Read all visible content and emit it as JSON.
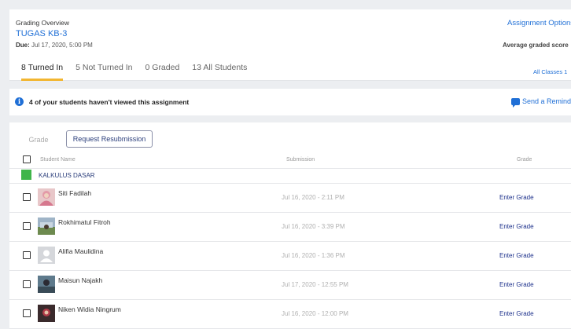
{
  "header": {
    "overview_label": "Grading Overview",
    "assignment_title": "TUGAS KB-3",
    "due_label": "Due:",
    "due_value": "Jul 17, 2020, 5:00 PM",
    "assignment_options": "Assignment Options",
    "average_label": "Average graded score"
  },
  "tabs": [
    {
      "label": "8 Turned In",
      "active": true
    },
    {
      "label": "5 Not Turned In",
      "active": false
    },
    {
      "label": "0 Graded",
      "active": false
    },
    {
      "label": "13 All Students",
      "active": false
    }
  ],
  "filter": {
    "classes_label": "All Classes 1"
  },
  "notice": {
    "text": "4 of your students haven't viewed this assignment",
    "remind_label": "Send a Reminder"
  },
  "toolbar": {
    "grade_label": "Grade",
    "resubmission_label": "Request Resubmission"
  },
  "table": {
    "columns": [
      "Student Name",
      "Submission",
      "Grade"
    ],
    "class_name": "KALKULUS DASAR",
    "class_color": "#3fb54a",
    "rows": [
      {
        "name": "Siti Fadilah",
        "submission": "Jul 16, 2020 - 2:11 PM",
        "grade": "Enter Grade"
      },
      {
        "name": "Rokhimatul Fitroh",
        "submission": "Jul 16, 2020 - 3:39 PM",
        "grade": "Enter Grade"
      },
      {
        "name": "Alifia Maulidina",
        "submission": "Jul 16, 2020 - 1:36 PM",
        "grade": "Enter Grade"
      },
      {
        "name": "Maisun Najakh",
        "submission": "Jul 17, 2020 - 12:55 PM",
        "grade": "Enter Grade"
      },
      {
        "name": "Niken Widia Ningrum",
        "submission": "Jul 16, 2020 - 12:00 PM",
        "grade": "Enter Grade"
      }
    ]
  },
  "colors": {
    "accent": "#1f6fd6",
    "tab_underline": "#f2b631",
    "link_dark": "#1a2e8a"
  }
}
